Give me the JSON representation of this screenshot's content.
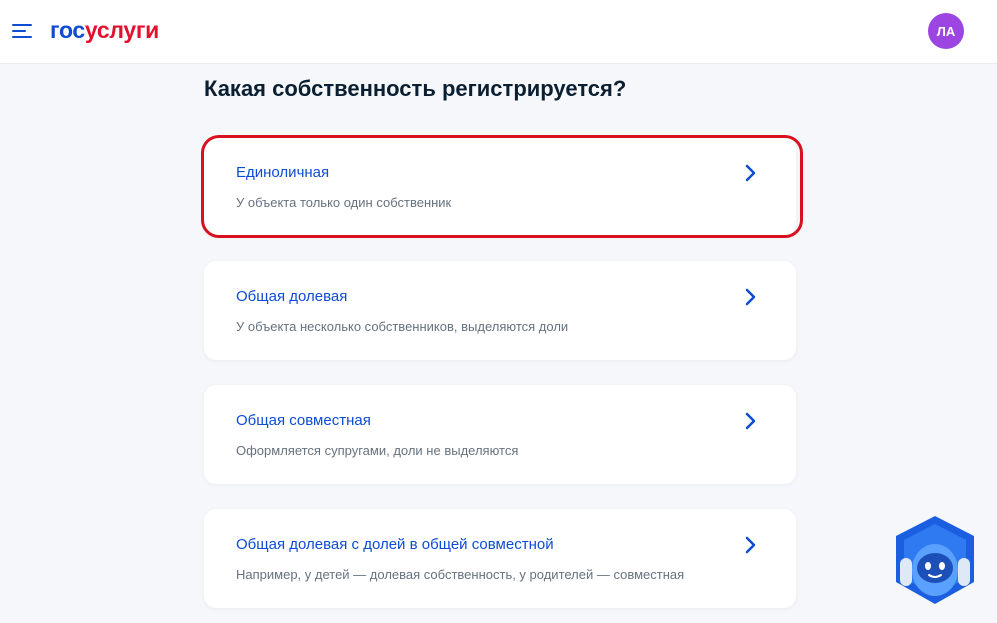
{
  "header": {
    "logo_part1": "гос",
    "logo_part2": "услуги",
    "avatar_initials": "ЛА"
  },
  "main": {
    "title": "Какая собственность регистрируется?",
    "options": [
      {
        "title": "Единоличная",
        "description": "У объекта только один собственник"
      },
      {
        "title": "Общая долевая",
        "description": "У объекта несколько собственников, выделяются доли"
      },
      {
        "title": "Общая совместная",
        "description": "Оформляется супругами, доли не выделяются"
      },
      {
        "title": "Общая долевая с долей в общей совместной",
        "description": "Например, у детей — долевая собственность, у родителей — совместная"
      }
    ]
  },
  "icons": {
    "menu": "hamburger-menu-icon",
    "chevron": "chevron-right-icon",
    "assistant": "robot-assistant-icon"
  },
  "colors": {
    "brand_blue": "#0d4cd3",
    "brand_red": "#e3102f",
    "avatar": "#9c45e0",
    "highlight": "#d8101f",
    "background": "#f5f7fa"
  }
}
